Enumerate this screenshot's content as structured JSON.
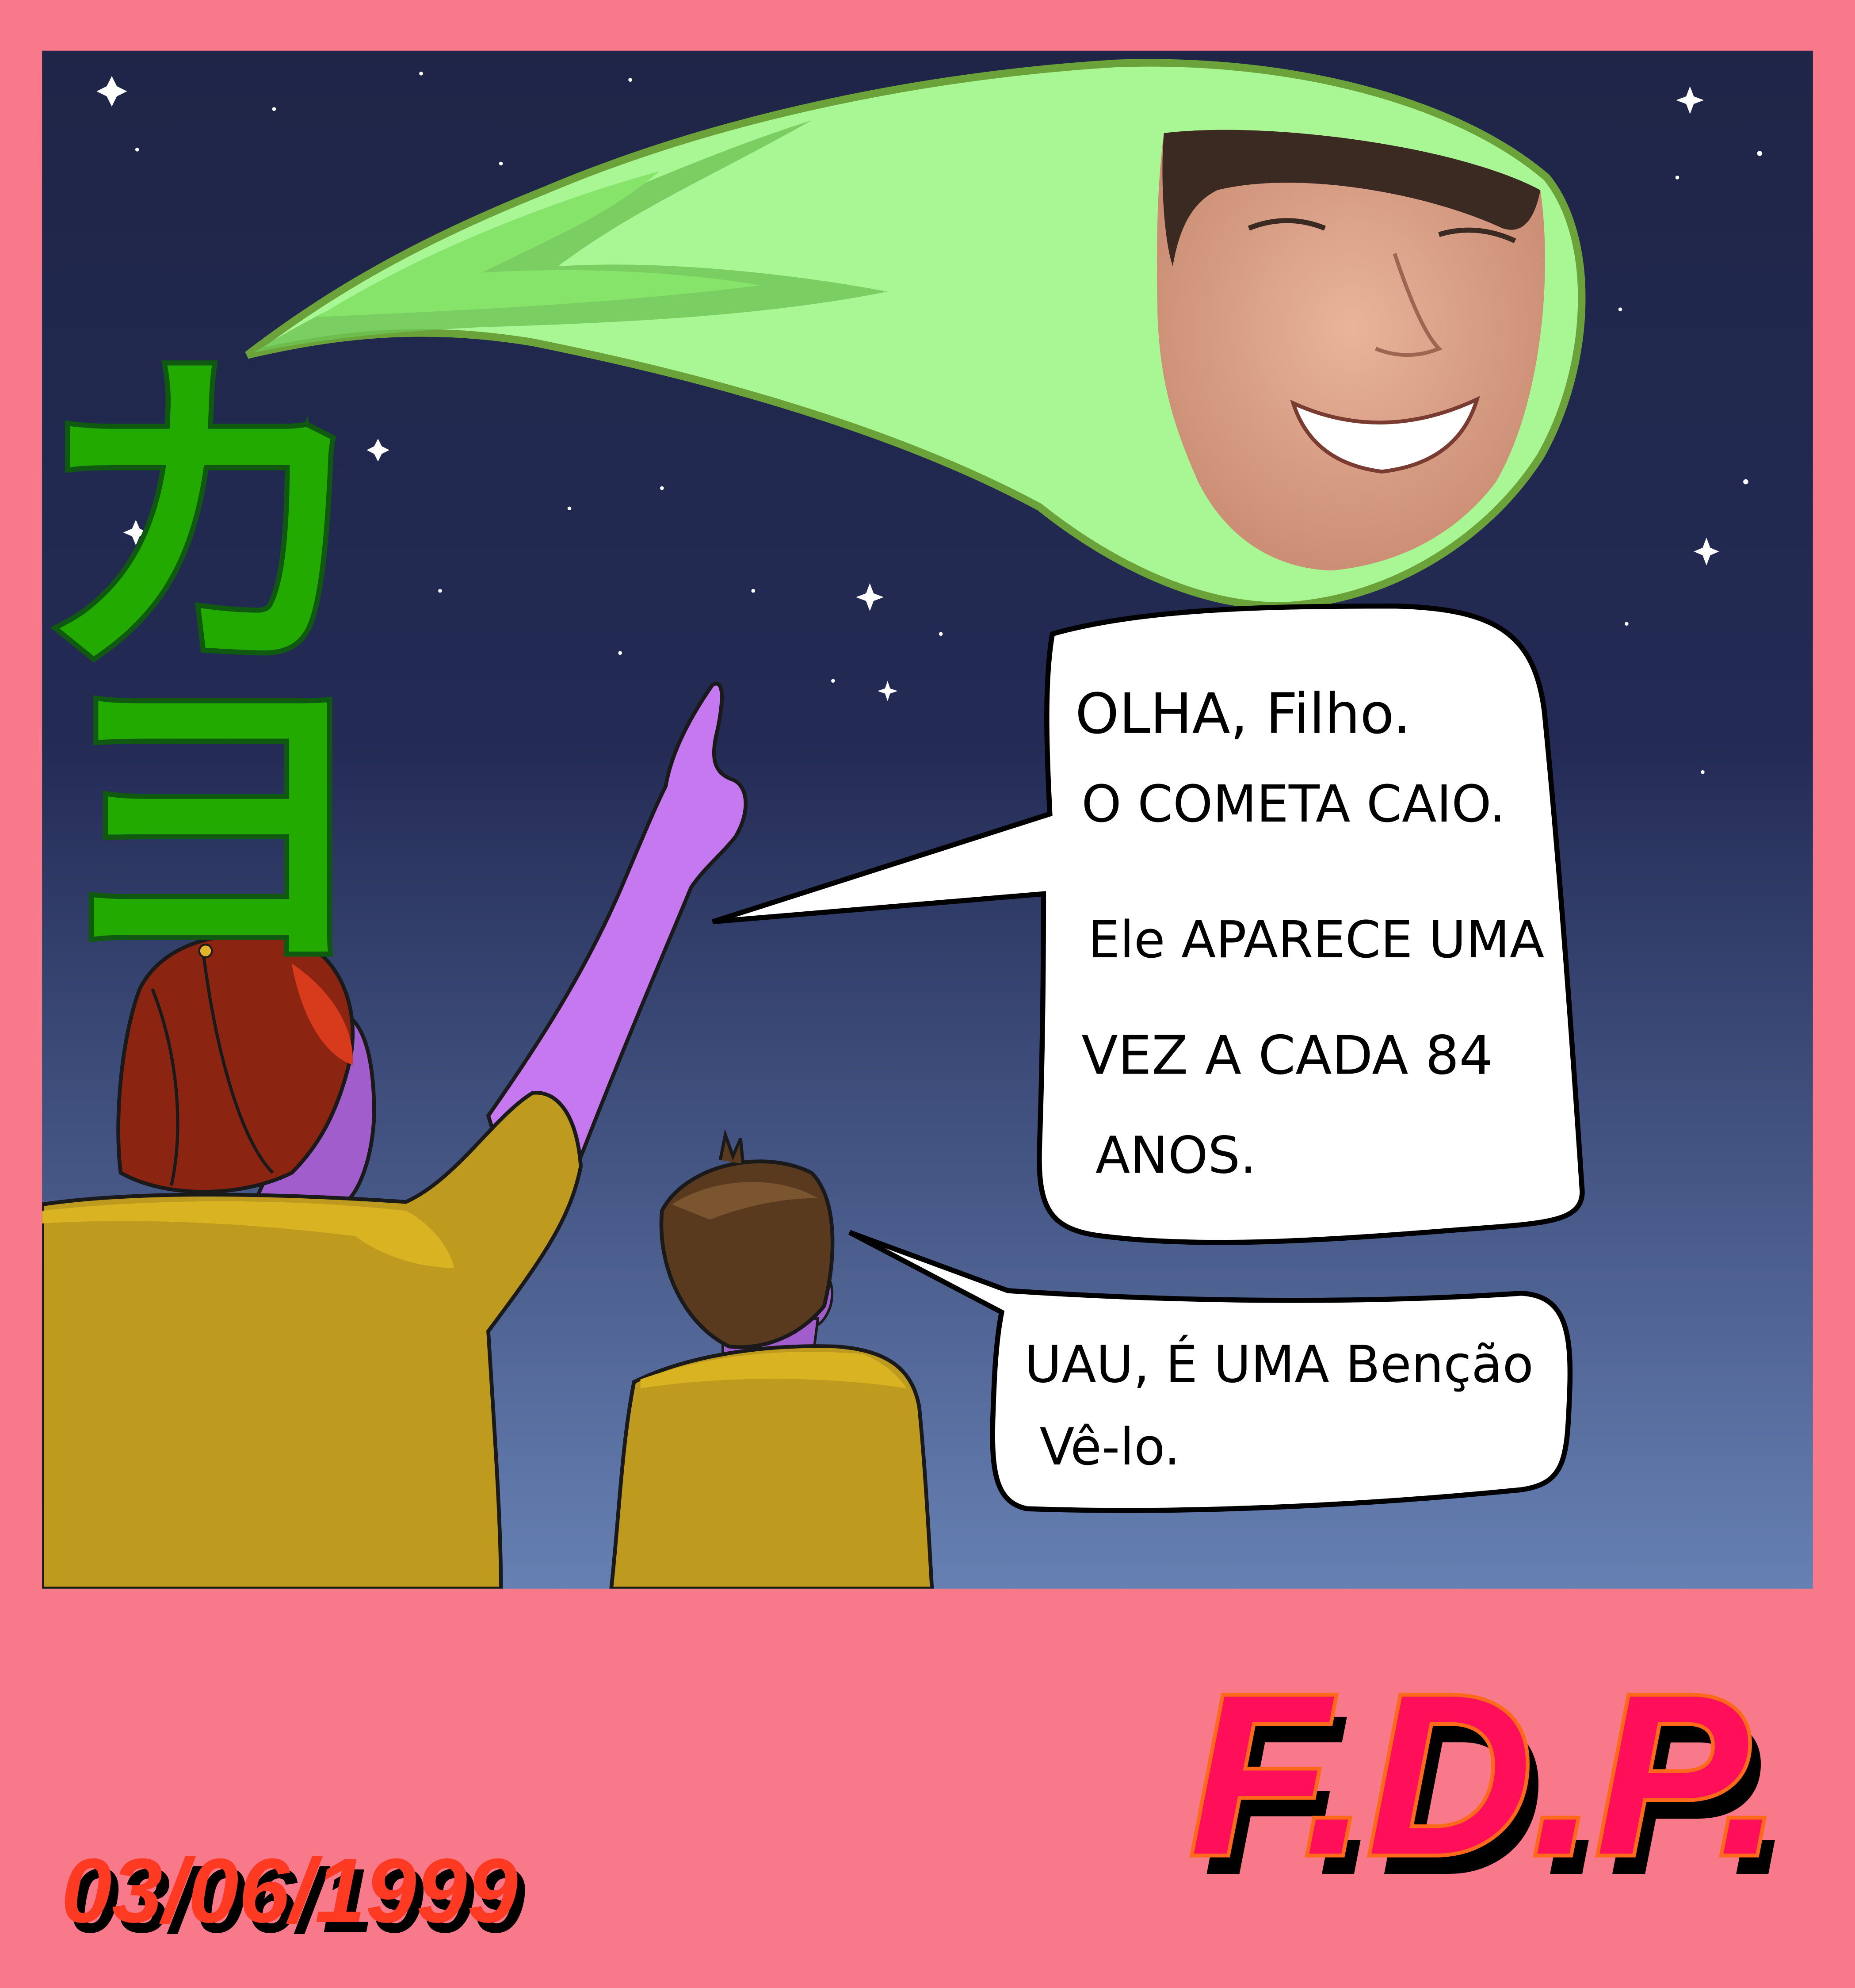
{
  "comic": {
    "katakana": [
      "カ",
      "ヨ"
    ],
    "speech_father": {
      "lines": [
        "OLHA, Filho.",
        "O COMETA CAIO.",
        "Ele APARECE UMA",
        "VEZ A CADA 84",
        "ANOS."
      ]
    },
    "speech_child": {
      "lines": [
        "UAU, É UMA Benção",
        "Vê-lo."
      ]
    },
    "signature": "F.D.P.",
    "date": "03/06/1999"
  },
  "colors": {
    "border": "#F87A8A",
    "sky_top": "#1F2547",
    "sky_bottom": "#6680B3",
    "comet": "#A8F794",
    "comet_edge": "#6BA33A",
    "katakana": "#22AA00",
    "shirt": "#BE9A1F",
    "cap": "#8B2410",
    "skin": "#C678F0",
    "signature": "#FF0E5A",
    "date": "#FF3A22"
  }
}
